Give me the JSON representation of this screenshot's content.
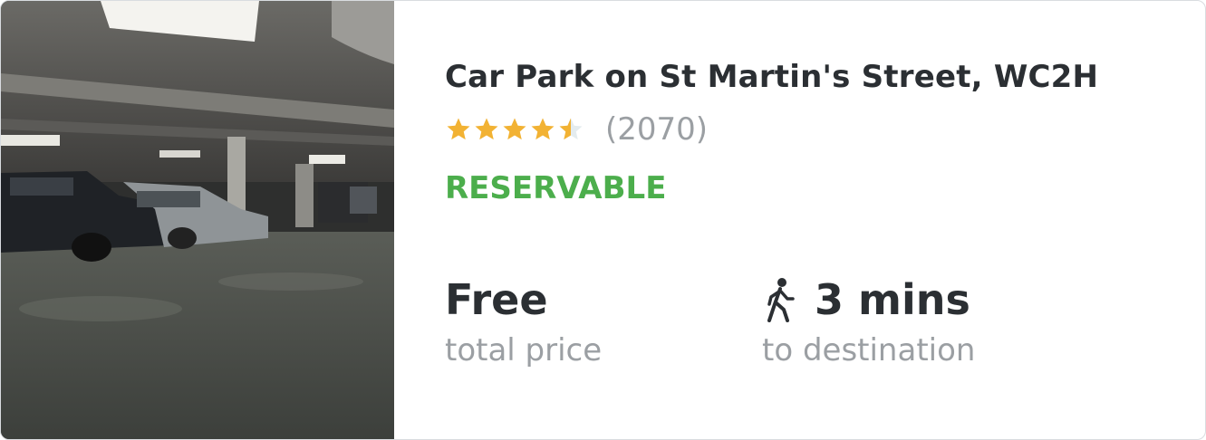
{
  "listing": {
    "title": "Car Park on St Martin's Street, WC2H",
    "rating": 4.5,
    "rating_max": 5,
    "review_count": "(2070)",
    "badge": "RESERVABLE",
    "price_value": "Free",
    "price_label": "total price",
    "walk_value": "3 mins",
    "walk_label": "to destination"
  },
  "icons": {
    "star": "star-icon",
    "walk": "walking-person-icon"
  },
  "colors": {
    "star_filled": "#f2b233",
    "star_empty": "#e4ecef",
    "badge": "#4cae4c",
    "title": "#2b2f33",
    "muted": "#9b9fa3"
  }
}
